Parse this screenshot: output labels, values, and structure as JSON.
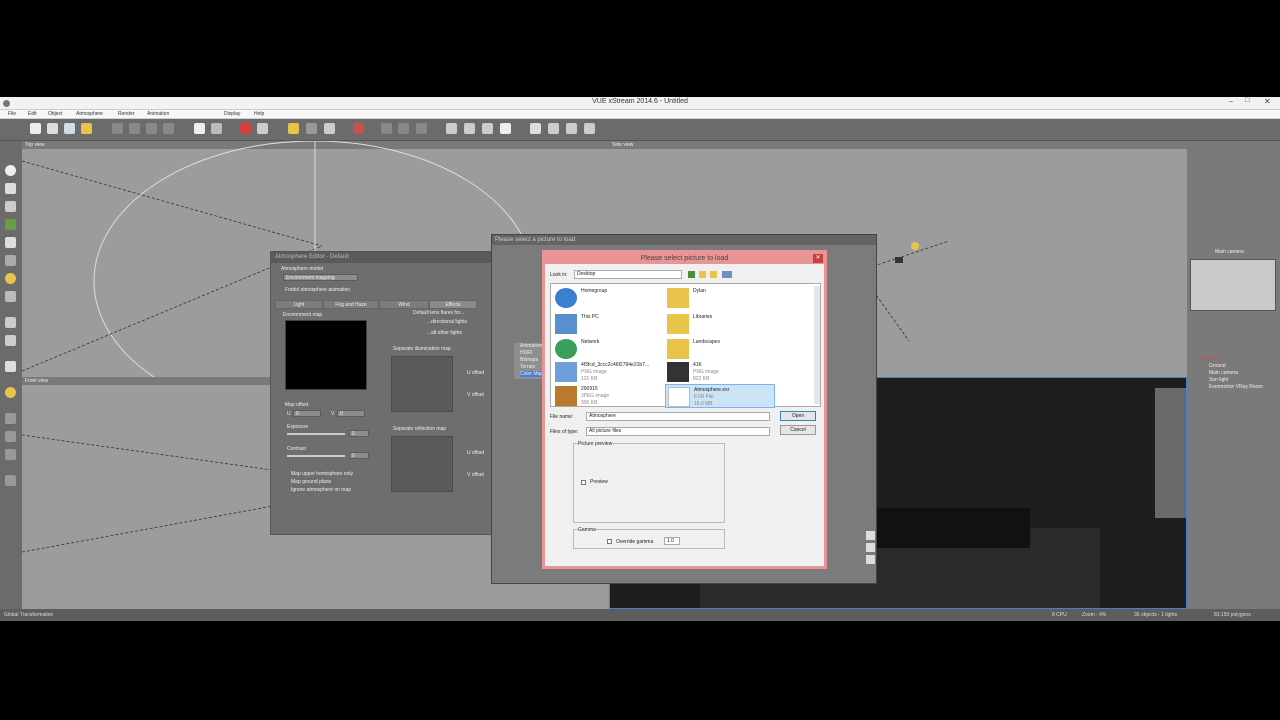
{
  "window": {
    "title": "VUE xStream 2014.6 - Untitled"
  },
  "menu": [
    "File",
    "Edit",
    "Object",
    "Atmosphere",
    "Render",
    "Animation",
    "Display",
    "Help"
  ],
  "viewports": {
    "top": "Top view",
    "side": "Side view",
    "front": "Front view",
    "main_camera": "Main camera"
  },
  "atmosphere_editor": {
    "title": "Atmosphere Editor - Default",
    "model_label": "Atmosphere model",
    "model_value": "Environment mapping",
    "forbid_animation": "Forbid atmosphere animation",
    "tabs": [
      "Light",
      "Fog and Haze",
      "Wind",
      "Effects"
    ],
    "active_tab": "Effects",
    "environment_map": "Environment map",
    "map_offset": "Map offset",
    "u_label": "U",
    "u_value": "0",
    "v_label": "V",
    "v_value": "0",
    "exposure": "Exposure",
    "exposure_value": "0",
    "contrast": "Contrast",
    "contrast_value": "0",
    "options": [
      "Map upper hemisphere only",
      "Map ground plane",
      "Ignore atmosphere on map"
    ],
    "lens_flares": "Default lens flares for...",
    "directional_lights": "...directional lights",
    "all_other_lights": "...all other lights",
    "separate_illumination": "Separate illumination map",
    "separate_reflection": "Separate reflection map",
    "u_offset": "U offset",
    "v_offset": "V offset"
  },
  "load_window": {
    "title": "Please select a picture to load",
    "list": [
      "Animation",
      "HDRI",
      "Bitmaps",
      "Terrain",
      "Color Maps"
    ]
  },
  "file_dialog": {
    "title": "Please select picture to load",
    "look_in_label": "Look in:",
    "look_in_value": "Desktop",
    "items": [
      {
        "name": "Homegroup",
        "type": "",
        "size": ""
      },
      {
        "name": "Dylan",
        "type": "",
        "size": ""
      },
      {
        "name": "This PC",
        "type": "",
        "size": ""
      },
      {
        "name": "Libraries",
        "type": "",
        "size": ""
      },
      {
        "name": "Network",
        "type": "",
        "size": ""
      },
      {
        "name": "Landscapes",
        "type": "",
        "size": ""
      },
      {
        "name": "4f3fcd_3ccc2c46f2794e21b7...",
        "type": "PNG image",
        "size": "121 KB"
      },
      {
        "name": "41K",
        "type": "PNG image",
        "size": "822 KB"
      },
      {
        "name": "290915",
        "type": "JPEG image",
        "size": "300 KB"
      },
      {
        "name": "Atmosphere.exr",
        "type": "EXR File",
        "size": "16.0 MB"
      }
    ],
    "file_name_label": "File name:",
    "file_name_value": "Atmosphere",
    "file_type_label": "Files of type:",
    "file_type_value": "All picture files",
    "open": "Open",
    "cancel": "Cancel",
    "preview_group": "Picture preview",
    "preview_label": "Preview",
    "gamma_group": "Gamma",
    "override_gamma": "Override gamma",
    "gamma_value": "1.0"
  },
  "right_panel": {
    "layer": "Layer 1",
    "objects": [
      "Ground",
      "Main camera",
      "Sun light",
      "Evermotion VRay Room"
    ]
  },
  "status": {
    "left": "Global Transformation",
    "cpu": "8 CPU",
    "zoom": "Zoom : 4%",
    "objects": "36 objects - 1 lights",
    "polygons": "83,150 polygons"
  },
  "colors": {
    "accent": "#e99595",
    "selection": "#cce4f7",
    "chrome": "#6b6b6b"
  }
}
